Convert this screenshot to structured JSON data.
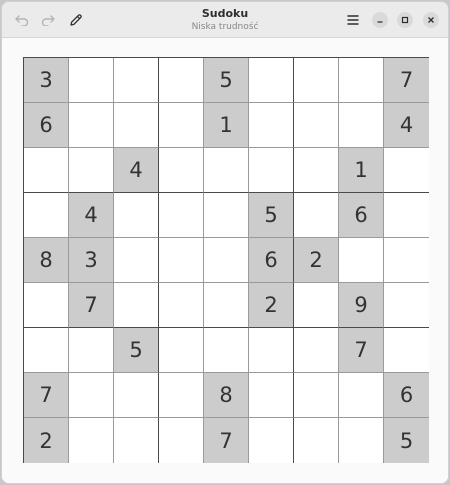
{
  "window": {
    "title": "Sudoku",
    "subtitle": "Niska trudność"
  },
  "toolbar": {
    "undo_icon": "undo-icon",
    "redo_icon": "redo-icon",
    "pencil_icon": "pencil-icon",
    "menu_icon": "hamburger-menu-icon",
    "minimize_icon": "minimize-icon",
    "maximize_icon": "maximize-icon",
    "close_icon": "close-icon"
  },
  "colors": {
    "given_cell": "#cccccc",
    "empty_cell": "#ffffff",
    "digit": "#333333"
  },
  "board": [
    [
      "3",
      "",
      "",
      "",
      "5",
      "",
      "",
      "",
      "7"
    ],
    [
      "6",
      "",
      "",
      "",
      "1",
      "",
      "",
      "",
      "4"
    ],
    [
      "",
      "",
      "4",
      "",
      "",
      "",
      "",
      "1",
      ""
    ],
    [
      "",
      "4",
      "",
      "",
      "",
      "5",
      "",
      "6",
      ""
    ],
    [
      "8",
      "3",
      "",
      "",
      "",
      "6",
      "2",
      "",
      ""
    ],
    [
      "",
      "7",
      "",
      "",
      "",
      "2",
      "",
      "9",
      ""
    ],
    [
      "",
      "",
      "5",
      "",
      "",
      "",
      "",
      "7",
      ""
    ],
    [
      "7",
      "",
      "",
      "",
      "8",
      "",
      "",
      "",
      "6"
    ],
    [
      "2",
      "",
      "",
      "",
      "7",
      "",
      "",
      "",
      "5"
    ]
  ]
}
